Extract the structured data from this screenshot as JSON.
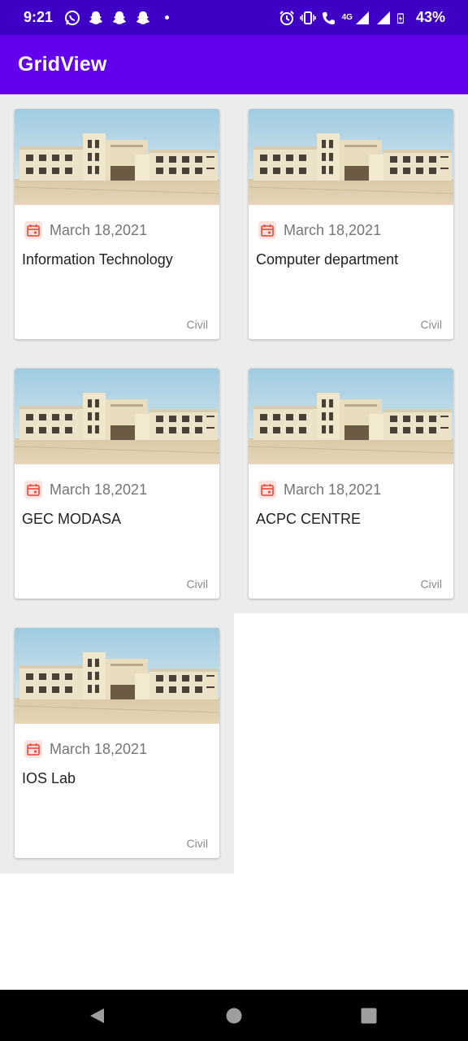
{
  "status_bar": {
    "time": "9:21",
    "notification_icons": [
      "whatsapp-icon",
      "snapchat-icon",
      "snapchat-icon",
      "snapchat-icon"
    ],
    "network_label": "4G",
    "battery": "43%"
  },
  "app_bar": {
    "title": "GridView"
  },
  "cards": [
    {
      "date": "March 18,2021",
      "title": "Information Technology",
      "tag": "Civil"
    },
    {
      "date": "March 18,2021",
      "title": "Computer department",
      "tag": "Civil"
    },
    {
      "date": "March 18,2021",
      "title": "GEC MODASA",
      "tag": "Civil"
    },
    {
      "date": "March 18,2021",
      "title": "ACPC CENTRE",
      "tag": "Civil"
    },
    {
      "date": "March 18,2021",
      "title": "IOS Lab",
      "tag": "Civil"
    }
  ],
  "colors": {
    "status_bar": "#3d00c4",
    "app_bar": "#6200ee",
    "grid_background": "#ececec",
    "calendar_icon": "#e8574a"
  }
}
